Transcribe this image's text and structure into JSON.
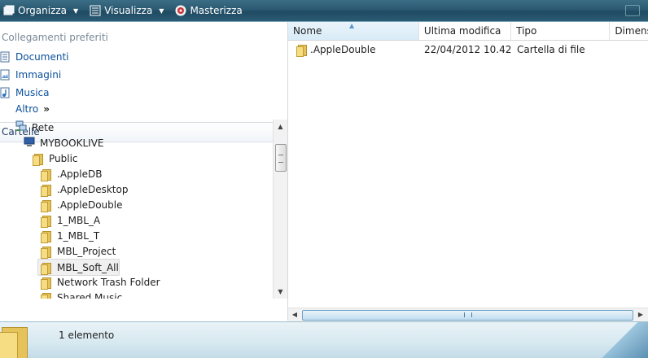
{
  "toolbar": {
    "organize_label": "Organizza",
    "view_label": "Visualizza",
    "burn_label": "Masterizza"
  },
  "nav": {
    "favorites_title": "Collegamenti preferiti",
    "favorites": [
      {
        "label": "Documenti",
        "icon": "document-icon"
      },
      {
        "label": "Immagini",
        "icon": "pictures-icon"
      },
      {
        "label": "Musica",
        "icon": "music-icon"
      }
    ],
    "more_label": "Altro",
    "more_chevron": "»",
    "folders_title": "Cartelle",
    "folders_chevron": "⌄",
    "tree": [
      {
        "label": "Rete",
        "icon": "network-icon"
      },
      {
        "label": "MYBOOKLIVE",
        "icon": "computer-icon"
      },
      {
        "label": "Public",
        "icon": "shared-folder-icon"
      },
      {
        "label": ".AppleDB",
        "icon": "folder-icon"
      },
      {
        "label": ".AppleDesktop",
        "icon": "folder-icon"
      },
      {
        "label": ".AppleDouble",
        "icon": "folder-icon"
      },
      {
        "label": "1_MBL_A",
        "icon": "folder-icon"
      },
      {
        "label": "1_MBL_T",
        "icon": "folder-icon"
      },
      {
        "label": "MBL_Project",
        "icon": "folder-icon"
      },
      {
        "label": "MBL_Soft_All",
        "icon": "folder-icon",
        "selected": true
      },
      {
        "label": "Network Trash Folder",
        "icon": "folder-icon"
      },
      {
        "label": "Shared Music",
        "icon": "folder-icon"
      }
    ]
  },
  "content": {
    "columns": [
      "Nome",
      "Ultima modifica",
      "Tipo",
      "Dimens"
    ],
    "rows": [
      {
        "name": ".AppleDouble",
        "modified": "22/04/2012 10.42",
        "type": "Cartella di file"
      }
    ]
  },
  "details": {
    "status": "1 elemento"
  },
  "colors": {
    "toolbar": "#2b5a72",
    "link": "#0a4f9b",
    "folder": "#f6dc82"
  }
}
